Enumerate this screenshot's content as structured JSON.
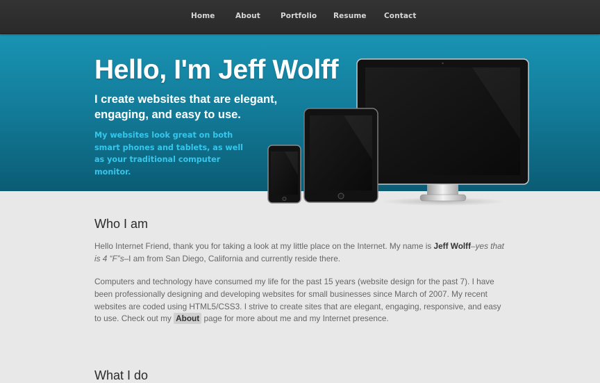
{
  "nav": {
    "items": [
      {
        "label": "Home"
      },
      {
        "label": "About"
      },
      {
        "label": "Portfolio"
      },
      {
        "label": "Resume"
      },
      {
        "label": "Contact"
      }
    ]
  },
  "hero": {
    "title": "Hello, I'm Jeff Wolff",
    "subtitle": "I create websites that are elegant, engaging, and easy to use.",
    "blurb": "My websites look great on both smart phones and tablets, as well as your traditional computer monitor."
  },
  "who": {
    "heading": "Who I am",
    "p1": {
      "before": "Hello Internet Friend, thank you for taking a look at my little place on the Internet. My name is ",
      "name": "Jeff Wolff",
      "italic": "–yes that is 4 “F”s",
      "after": "–I am from San Diego, California and currently reside there."
    },
    "p2": {
      "before": "Computers and technology have consumed my life for the past 15 years (website design for the past 7). I have been professionally designing and developing websites for small businesses since March of 2007. My recent websites are coded using HTML5/CSS3. I strive to create sites that are elegant, engaging, responsive, and easy to use. Check out my ",
      "link": "About",
      "after": " page for more about me and my Internet presence."
    }
  },
  "what": {
    "heading": "What I do"
  },
  "colors": {
    "accent": "#36c6ec",
    "hero_top": "#1a93b3",
    "hero_bottom": "#0b5c74",
    "nav_bg": "#2f2f2f",
    "page_bg": "#e8e8e8"
  }
}
